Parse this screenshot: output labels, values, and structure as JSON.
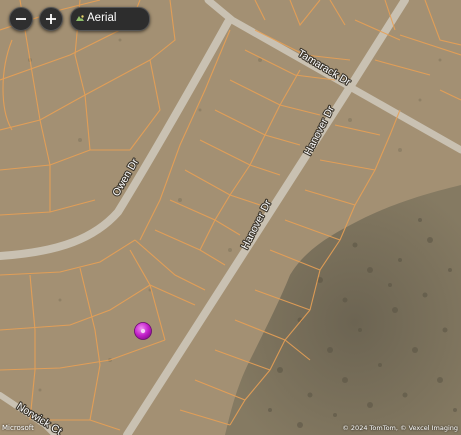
{
  "controls": {
    "layer_label": "Aerial"
  },
  "streets": {
    "tamarack": "Tamarack Dr",
    "hanover_upper": "Hanover Dr",
    "hanover_lower": "Hanover Dr",
    "owen": "Owen Dr",
    "norwick": "Norwick Ct"
  },
  "attribution": {
    "logo": "Microsoft",
    "copyright": "© 2024 TomTom, © Vexcel Imaging"
  },
  "colors": {
    "parcel_line": "#e8a055",
    "marker": "#c21fc9",
    "road": "#c9c1b2"
  }
}
